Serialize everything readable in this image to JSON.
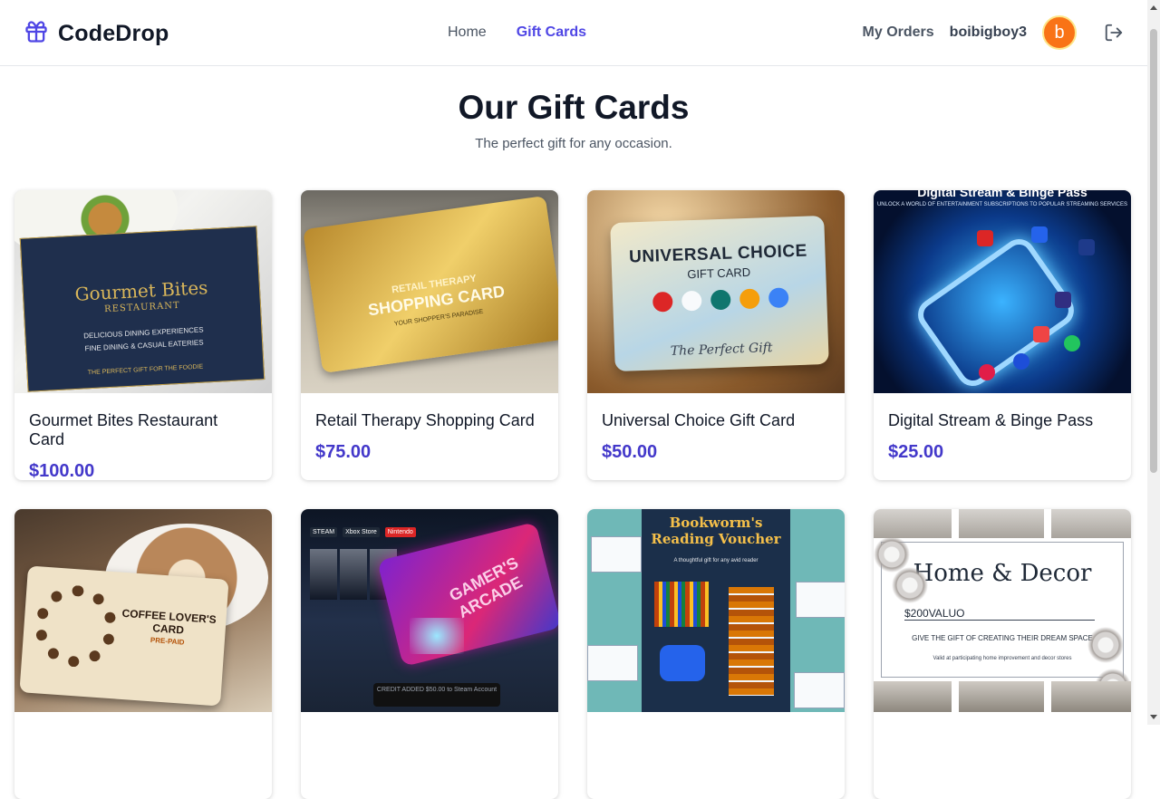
{
  "app": {
    "name": "CodeDrop",
    "accent": "#4f46e5",
    "price_color": "#4338ca"
  },
  "nav": {
    "items": [
      {
        "label": "Home",
        "active": false
      },
      {
        "label": "Gift Cards",
        "active": true
      }
    ]
  },
  "user": {
    "orders_label": "My Orders",
    "username": "boibigboy3",
    "avatar_initial": "b",
    "avatar_color": "#f97316",
    "logout_icon": "logout-icon"
  },
  "page": {
    "title": "Our Gift Cards",
    "subtitle": "The perfect gift for any occasion."
  },
  "cards": [
    {
      "title": "Gourmet Bites Restaurant Card",
      "price": "$100.00",
      "image_text": {
        "line1": "Gourmet Bites",
        "line2": "RESTAURANT",
        "line3": "DELICIOUS DINING EXPERIENCES",
        "line4": "FINE DINING & CASUAL EATERIES",
        "line5": "THE PERFECT GIFT FOR THE FOODIE"
      }
    },
    {
      "title": "Retail Therapy Shopping Card",
      "price": "$75.00",
      "image_text": {
        "line1": "RETAIL THERAPY",
        "line2": "SHOPPING CARD",
        "line3": "YOUR SHOPPER'S PARADISE"
      }
    },
    {
      "title": "Universal Choice Gift Card",
      "price": "$50.00",
      "image_text": {
        "line1": "UNIVERSAL CHOICE",
        "line2": "GIFT CARD",
        "line3": "The Perfect Gift"
      }
    },
    {
      "title": "Digital Stream & Binge Pass",
      "price": "$25.00",
      "image_text": {
        "line1": "Digital Stream & Binge Pass",
        "line2": "UNLOCK A WORLD OF ENTERTAINMENT SUBSCRIPTIONS TO POPULAR STREAMING SERVICES"
      }
    },
    {
      "title": "",
      "price": "",
      "image_text": {
        "line1": "COFFEE LOVER'S CARD",
        "line2": "PRE-PAID"
      }
    },
    {
      "title": "",
      "price": "",
      "image_text": {
        "line1": "GAMER'S ARCADE",
        "line2": "STEAM",
        "line3": "Xbox Store",
        "line4": "Nintendo",
        "line5": "CREDIT ADDED $50.00 to Steam Account"
      }
    },
    {
      "title": "",
      "price": "",
      "image_text": {
        "line1": "Bookworm's Reading Voucher",
        "line2": "A thoughtful gift for any avid reader"
      }
    },
    {
      "title": "",
      "price": "",
      "image_text": {
        "line1": "Home & Decor",
        "line2": "$200VALUO",
        "line3": "GIVE THE GIFT OF CREATING THEIR DREAM SPACE",
        "line4": "Valid at participating home improvement and decor stores"
      }
    }
  ]
}
